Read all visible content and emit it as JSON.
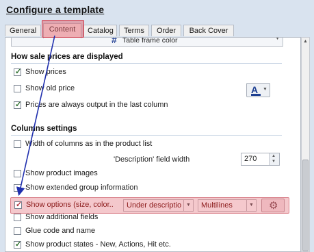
{
  "window": {
    "title": "Configure a template"
  },
  "tabs": [
    {
      "label": "General"
    },
    {
      "label": "Content",
      "active": true
    },
    {
      "label": "Catalog"
    },
    {
      "label": "Terms"
    },
    {
      "label": "Order"
    },
    {
      "label": "Back Cover"
    }
  ],
  "top_dropdown": {
    "value": "Table frame color"
  },
  "sale_prices": {
    "header": "How sale prices are displayed",
    "show_prices": {
      "label": "Show prices",
      "checked": true
    },
    "show_old_price": {
      "label": "Show old price",
      "checked": false
    },
    "last_column": {
      "label": "Prices are always output in the last column",
      "checked": true
    },
    "color_button_letter": "A"
  },
  "columns": {
    "header": "Columns settings",
    "width_as_list": {
      "label": "Width of columns as in the product list",
      "checked": false
    },
    "description_width": {
      "label": "'Description' field width",
      "value": "270"
    },
    "show_images": {
      "label": "Show product images",
      "checked": false
    },
    "extended_group": {
      "label": "Show extended group information",
      "checked": false
    },
    "show_options": {
      "label": "Show options (size, color..",
      "checked": true,
      "position_select": "Under descriptio",
      "mode_select": "Multilines"
    },
    "additional_fields": {
      "label": "Show additional fields",
      "checked": false
    },
    "glue_code": {
      "label": "Glue code and name",
      "checked": false
    },
    "product_states": {
      "label": "Show product states - New, Actions, Hit etc.",
      "checked": true
    }
  },
  "colors": {
    "highlight": "#e25460",
    "arrow": "#1f2fae"
  }
}
